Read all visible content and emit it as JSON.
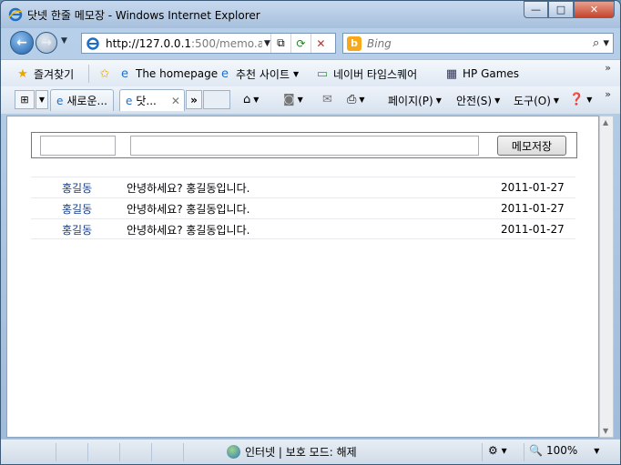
{
  "window": {
    "title": "닷넷 한줄 메모장 - Windows Internet Explorer",
    "minimize_label": "—",
    "maximize_label": "□",
    "close_label": "✕"
  },
  "navigation": {
    "address_host": "http://127.0.0.1",
    "address_rest": ":500/memo.a",
    "search_placeholder": "Bing"
  },
  "favorites_bar": {
    "favorites_label": "즐겨찾기",
    "items": [
      {
        "label": "The homepage"
      },
      {
        "label": "추천 사이트"
      },
      {
        "label": "네이버 타임스퀘어"
      },
      {
        "label": "HP Games"
      }
    ]
  },
  "tabs": [
    {
      "label": "새로운..."
    },
    {
      "label": "닷..."
    }
  ],
  "tab_more_label": "»",
  "command_bar": {
    "page_label": "페이지(P)",
    "safety_label": "안전(S)",
    "tools_label": "도구(O)"
  },
  "memo_form": {
    "name_value": "",
    "memo_value": "",
    "save_label": "메모저장"
  },
  "memos": [
    {
      "name": "홍길동",
      "memo": "안녕하세요? 홍길동입니다.",
      "date": "2011-01-27"
    },
    {
      "name": "홍길동",
      "memo": "안녕하세요? 홍길동입니다.",
      "date": "2011-01-27"
    },
    {
      "name": "홍길동",
      "memo": "안녕하세요? 홍길동입니다.",
      "date": "2011-01-27"
    }
  ],
  "status_bar": {
    "zone_text": "인터넷 | 보호 모드: 해제",
    "zoom": "100%"
  },
  "colors": {
    "accent_name": "#1a3f8a",
    "window_frame": "#b9d1ea"
  }
}
